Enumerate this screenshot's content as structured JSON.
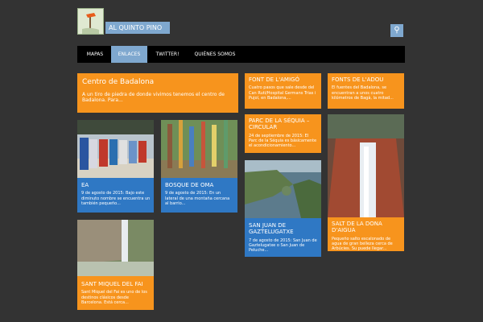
{
  "header": {
    "site_title": "AL QUINTO PINO",
    "logo_icon": "signpost-logo-icon",
    "search_icon": "search-icon"
  },
  "nav": [
    {
      "label": "MAPAS"
    },
    {
      "label": "ENLACES"
    },
    {
      "label": "TWITTER!"
    },
    {
      "label": "QUIÉNES SOMOS"
    }
  ],
  "cards": {
    "featured": {
      "title": "Centro de Badalona",
      "text": "A un tiro de piedra de donde vivimos tenemos el centro de Badalona. Para..."
    },
    "font_amigo": {
      "title": "FONT DE L'AMIGÓ",
      "text": "Cuatro pasos que sale desde del Can Ruti/Hospital Germans Trias i Pujol, en Badalona,..."
    },
    "fonts_adou": {
      "title": "FONTS DE L'ADOU",
      "text": "El fuentes del Badalona, se encuentran a unos cuatro kilómetros de Bagà, la mitad..."
    },
    "parc_sequia": {
      "title": "PARC DE LA SÉQUIA – CIRCULAR",
      "text": "24 de septiembre de 2015: El Parc de la Séquia es básicamente el acondicionamiento..."
    },
    "ea": {
      "title": "EA",
      "text": "9 de agosto de 2015: Bajo este diminuto nombre se encuentra un también pequeño..."
    },
    "bosque_oma": {
      "title": "BOSQUE DE OMA",
      "text": "9 de agosto de 2015: En un lateral de una montaña cercana al barrio..."
    },
    "gaztelugatxe": {
      "title": "SAN JUAN DE GAZTELUGATXE",
      "text": "7 de agosto de 2015: San Juan de Gaztelugatxe o San Juan de Peluche..."
    },
    "dona_aigua": {
      "title": "SALT DE LA DONA D'AIGUA",
      "text": "Pequeño salto escalonado de agua de gran belleza cerca de Arbúcies. Su puede llegar..."
    },
    "sant_miquel": {
      "title": "SANT MIQUEL DEL FAI",
      "text": "Sant Miquel del Fai es uno de los destinos clásicos desde Barcelona. Está cerca..."
    }
  },
  "colors": {
    "orange": "#f7941d",
    "blue": "#2f78c4",
    "nav_active": "#7fa8cf",
    "background": "#333333"
  }
}
